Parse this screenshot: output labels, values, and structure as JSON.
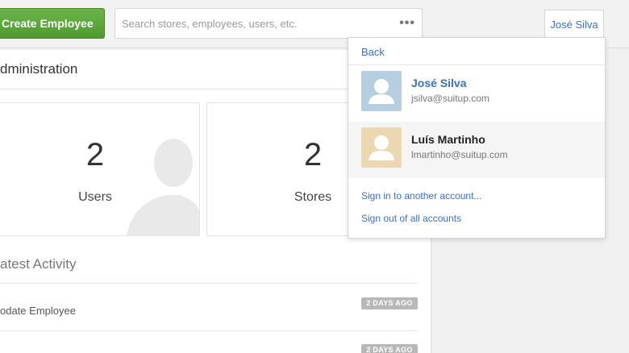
{
  "header": {
    "create_button": "Create Employee",
    "search_placeholder": "Search stores, employees, users, etc.",
    "more_icon": "ellipsis-icon",
    "current_user": "José Silva"
  },
  "main": {
    "title": "dministration",
    "cards": [
      {
        "number": "2",
        "label": "Users",
        "icon": "person-silhouette-icon"
      },
      {
        "number": "2",
        "label": "Stores"
      }
    ],
    "activity": {
      "title": "atest Activity",
      "items": [
        {
          "text": "odate Employee",
          "badge": "2 DAYS AGO"
        },
        {
          "text": "",
          "badge": "2 DAYS AGO"
        }
      ]
    }
  },
  "dropdown": {
    "back": "Back",
    "accounts": [
      {
        "name": "José Silva",
        "email": "jsilva@suitup.com",
        "avatar_color": "#b7cde0"
      },
      {
        "name": "Luís Martinho",
        "email": "lmartinho@suitup.com",
        "avatar_color": "#ecd8b0"
      }
    ],
    "sign_in_another": "Sign in to another account...",
    "sign_out_all": "Sign out of all accounts"
  },
  "colors": {
    "accent": "#3a6fc4",
    "create_button": "#5ca83a",
    "badge": "#b8b8b8"
  }
}
